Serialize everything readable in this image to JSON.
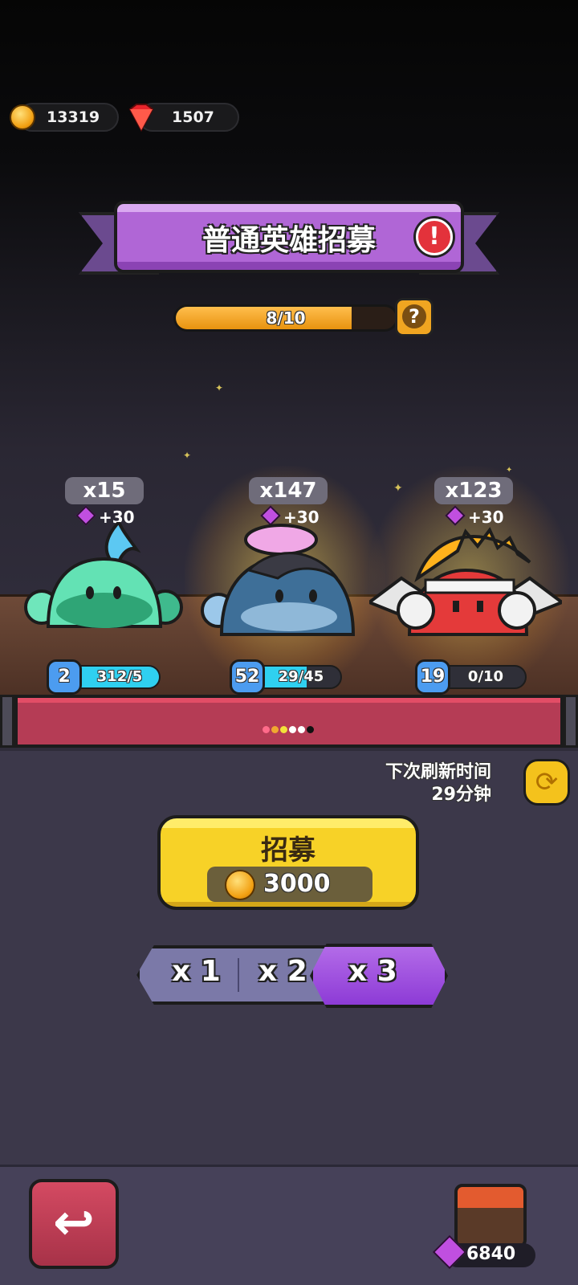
{
  "top_bar": {
    "coins": "13319",
    "gems": "1507"
  },
  "banner": {
    "title": "普通英雄招募"
  },
  "progress": {
    "label": "8/10",
    "value": 8,
    "max": 10,
    "help_label": "?"
  },
  "heroes": [
    {
      "count": "x15",
      "bonus": "+30",
      "level": "2",
      "shards": "312/5",
      "fill": 1.0,
      "color": "#5fe0b0"
    },
    {
      "count": "x147",
      "bonus": "+30",
      "level": "52",
      "shards": "29/45",
      "fill": 0.64,
      "color": "#3f7fb0"
    },
    {
      "count": "x123",
      "bonus": "+30",
      "level": "19",
      "shards": "0/10",
      "fill": 0.0,
      "color": "#e43a3a"
    }
  ],
  "refresh": {
    "line1": "下次刷新时间",
    "line2": "29分钟"
  },
  "recruit": {
    "label": "招募",
    "price": "3000"
  },
  "multipliers": {
    "x1": "x 1",
    "x2": "x 2",
    "x3": "x 3",
    "selected": "x 3"
  },
  "shop": {
    "gems": "6840"
  },
  "colors": {
    "banner": "#b066d6",
    "recruit": "#f7d227",
    "back": "#b43a52"
  }
}
